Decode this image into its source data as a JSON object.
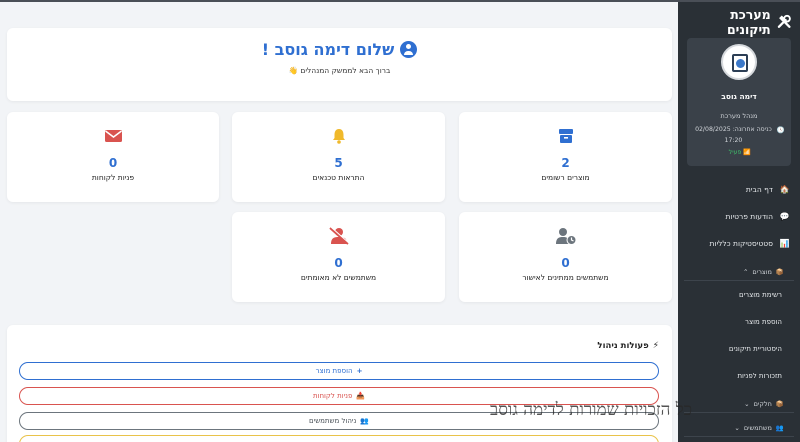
{
  "app": {
    "title": "מערכת תיקונים"
  },
  "profile": {
    "name": "דימה גוסב",
    "role": "מנהל מערכת",
    "last_login": "כניסה אחרונה: 02/08/2025 17:20",
    "status": "פעיל"
  },
  "sidebar": {
    "items": [
      {
        "label": "דף הבית",
        "icon": "home-icon"
      },
      {
        "label": "הודעות פרטיות",
        "icon": "chat-icon"
      },
      {
        "label": "סטטיסטיקות כלליות",
        "icon": "chart-icon"
      }
    ],
    "sections": [
      {
        "label": "מוצרים",
        "icon": "box-icon",
        "subitems": [
          "רשימת מוצרים",
          "הוספת מוצר",
          "היסטוריית תיקונים",
          "תזכורות לפניות"
        ]
      },
      {
        "label": "חלקים",
        "icon": "box-icon"
      },
      {
        "label": "משתמשים",
        "icon": "users-icon"
      }
    ]
  },
  "welcome": {
    "title": "שלום דימה גוסב !",
    "subtitle": "ברוך הבא לממשק המנהלים 👋"
  },
  "stats": [
    {
      "value": "2",
      "label": "מוצרים רשומים",
      "icon": "box-icon",
      "color": "#2f6fd1"
    },
    {
      "value": "5",
      "label": "התראות טכנאים",
      "icon": "bell-icon",
      "color": "#f0b92b"
    },
    {
      "value": "0",
      "label": "פניות לקוחות",
      "icon": "envelope-icon",
      "color": "#d9534f"
    },
    {
      "value": "0",
      "label": "משתמשים ממתינים לאישור",
      "icon": "user-clock-icon",
      "color": "#6c757d"
    },
    {
      "value": "0",
      "label": "משתמשים לא מאומתים",
      "icon": "user-slash-icon",
      "color": "#d9534f"
    }
  ],
  "actions": {
    "title": "פעולות ניהול",
    "buttons": [
      {
        "label": "הוספת מוצר",
        "icon": "plus-icon"
      },
      {
        "label": "פניות לקוחות",
        "icon": "inbox-icon"
      },
      {
        "label": "ניהול משתמשים",
        "icon": "users-icon"
      }
    ]
  },
  "watermark": "כל הזכויות שמורות לדימה גוסב"
}
